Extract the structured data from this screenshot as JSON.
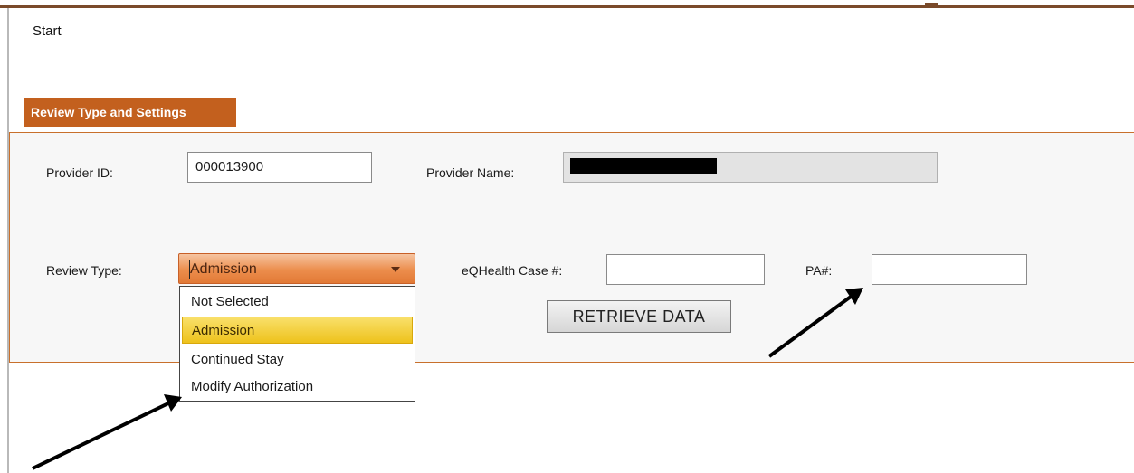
{
  "tabs": [
    {
      "label": "Start"
    }
  ],
  "panel": {
    "title": "Review Type and Settings"
  },
  "provider": {
    "id_label": "Provider ID:",
    "id_value": "000013900",
    "name_label": "Provider Name:",
    "name_value": ""
  },
  "review": {
    "type_label": "Review Type:",
    "type_value": "Admission",
    "options": [
      "Not Selected",
      "Admission",
      "Continued Stay",
      "Modify Authorization"
    ],
    "selected_index": 1
  },
  "case": {
    "label": "eQHealth Case #:",
    "value": ""
  },
  "pa": {
    "label": "PA#:",
    "value": ""
  },
  "retrieve_button": {
    "label": "RETRIEVE DATA"
  },
  "colors": {
    "accent": "#c3601e",
    "selected_item": "#f2cc2e"
  }
}
